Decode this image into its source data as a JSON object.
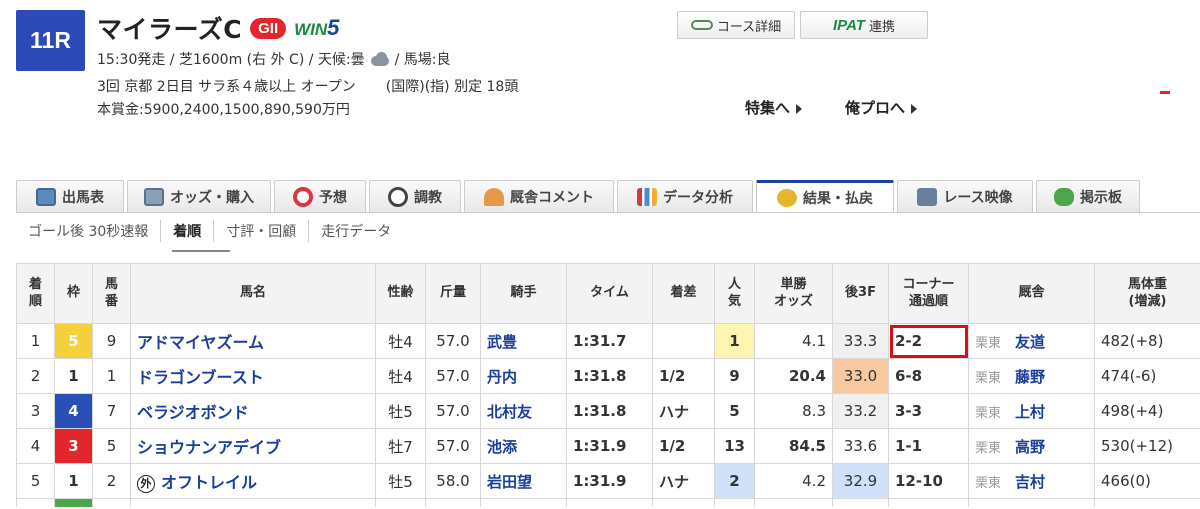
{
  "race": {
    "number": "11R",
    "name": "マイラーズC",
    "grade": "GII",
    "win5_prefix": "WIN",
    "win5_suffix": "5",
    "data1_a": "15:30発走 / 芝1600m (右 外 C) / 天候:曇",
    "data1_b": "/ 馬場:良",
    "data2_a": "3回 京都 2日目 サラ系４歳以上 オープン",
    "data2_b": "(国際)(指) 別定 18頭",
    "data3": "本賞金:5900,2400,1500,890,590万円"
  },
  "header_buttons": {
    "course_label": "コース詳細",
    "ipat_logo": "IPAT",
    "ipat_label": "連携",
    "tokushu_link": "特集へ",
    "orepro_link": "俺プロへ"
  },
  "main_tabs": [
    {
      "label": "出馬表",
      "icon": "entry-table-icon"
    },
    {
      "label": "オッズ・購入",
      "icon": "odds-icon"
    },
    {
      "label": "予想",
      "icon": "target-icon"
    },
    {
      "label": "調教",
      "icon": "stopwatch-icon"
    },
    {
      "label": "厩舎コメント",
      "icon": "stable-icon"
    },
    {
      "label": "データ分析",
      "icon": "bar-chart-icon"
    },
    {
      "label": "結果・払戻",
      "icon": "coins-icon"
    },
    {
      "label": "レース映像",
      "icon": "video-icon"
    },
    {
      "label": "掲示板",
      "icon": "chat-icon"
    }
  ],
  "sub_tabs": [
    {
      "label": "ゴール後 30秒速報"
    },
    {
      "label": "着順"
    },
    {
      "label": "寸評・回顧"
    },
    {
      "label": "走行データ"
    }
  ],
  "table": {
    "headers": {
      "rank_1": "着",
      "rank_2": "順",
      "waku": "枠",
      "umaban_1": "馬",
      "umaban_2": "番",
      "name": "馬名",
      "sexage": "性齢",
      "weight": "斤量",
      "jockey": "騎手",
      "time": "タイム",
      "margin": "着差",
      "pop_1": "人",
      "pop_2": "気",
      "odds_1": "単勝",
      "odds_2": "オッズ",
      "f3": "後3F",
      "corner_1": "コーナー",
      "corner_2": "通過順",
      "trainer": "厩舎",
      "hweight_1": "馬体重",
      "hweight_2": "(増減)"
    },
    "rows": [
      {
        "rank": "1",
        "waku": "5",
        "umaban": "9",
        "name": "アドマイヤズーム",
        "gai": "",
        "sexage": "牡4",
        "weight": "57.0",
        "jockey": "武豊",
        "time": "1:31.7",
        "margin": "",
        "pop": "1",
        "odds": "4.1",
        "f3": "33.3",
        "corner": "2-2",
        "region": "栗東",
        "trainer": "友道",
        "hweight": "482(+8)"
      },
      {
        "rank": "2",
        "waku": "1",
        "umaban": "1",
        "name": "ドラゴンブースト",
        "gai": "",
        "sexage": "牡4",
        "weight": "57.0",
        "jockey": "丹内",
        "time": "1:31.8",
        "margin": "1/2",
        "pop": "9",
        "odds": "20.4",
        "f3": "33.0",
        "corner": "6-8",
        "region": "栗東",
        "trainer": "藤野",
        "hweight": "474(-6)"
      },
      {
        "rank": "3",
        "waku": "4",
        "umaban": "7",
        "name": "ベラジオボンド",
        "gai": "",
        "sexage": "牡5",
        "weight": "57.0",
        "jockey": "北村友",
        "time": "1:31.8",
        "margin": "ハナ",
        "pop": "5",
        "odds": "8.3",
        "f3": "33.2",
        "corner": "3-3",
        "region": "栗東",
        "trainer": "上村",
        "hweight": "498(+4)"
      },
      {
        "rank": "4",
        "waku": "3",
        "umaban": "5",
        "name": "ショウナンアデイブ",
        "gai": "",
        "sexage": "牡7",
        "weight": "57.0",
        "jockey": "池添",
        "time": "1:31.9",
        "margin": "1/2",
        "pop": "13",
        "odds": "84.5",
        "f3": "33.6",
        "corner": "1-1",
        "region": "栗東",
        "trainer": "高野",
        "hweight": "530(+12)"
      },
      {
        "rank": "5",
        "waku": "1",
        "umaban": "2",
        "name": "オフトレイル",
        "gai": "外",
        "sexage": "牡5",
        "weight": "58.0",
        "jockey": "岩田望",
        "time": "1:31.9",
        "margin": "ハナ",
        "pop": "2",
        "odds": "4.2",
        "f3": "32.9",
        "corner": "12-10",
        "region": "栗東",
        "trainer": "吉村",
        "hweight": "466(0)"
      }
    ]
  },
  "colors": {
    "race_badge": "#2b49b7",
    "grade_badge": "#e2262b",
    "link_blue": "#1a3f9a",
    "odds_red": "#d9363e",
    "highlight_box": "#d4101a"
  }
}
